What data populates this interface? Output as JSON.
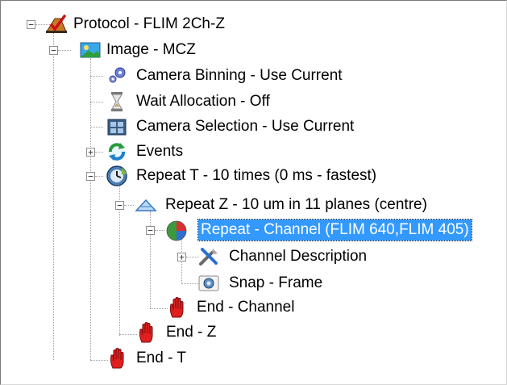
{
  "tree": {
    "nodes": [
      {
        "id": "protocol",
        "label": "Protocol - FLIM 2Ch-Z",
        "icon": "protocol-check-icon",
        "expander": "minus"
      },
      {
        "id": "image",
        "label": "Image - MCZ",
        "icon": "image-landscape-icon",
        "expander": "minus"
      },
      {
        "id": "binning",
        "label": "Camera Binning - Use Current",
        "icon": "gears-icon",
        "expander": ""
      },
      {
        "id": "wait",
        "label": "Wait Allocation - Off",
        "icon": "hourglass-icon",
        "expander": ""
      },
      {
        "id": "camsel",
        "label": "Camera Selection - Use Current",
        "icon": "film-camera-icon",
        "expander": ""
      },
      {
        "id": "events",
        "label": "Events",
        "icon": "refresh-arrows-icon",
        "expander": "plus"
      },
      {
        "id": "repeat_t",
        "label": "Repeat T - 10 times (0 ms - fastest)",
        "icon": "clock-globe-icon",
        "expander": "minus"
      },
      {
        "id": "repeat_z",
        "label": "Repeat Z - 10 um in 11 planes (centre)",
        "icon": "z-stack-triangle-icon",
        "expander": "minus"
      },
      {
        "id": "repeat_ch",
        "label": "Repeat - Channel (FLIM 640,FLIM 405)",
        "icon": "pie-channel-icon",
        "expander": "minus",
        "selected": true
      },
      {
        "id": "chdesc",
        "label": "Channel Description",
        "icon": "tools-icon",
        "expander": "plus"
      },
      {
        "id": "snap",
        "label": "Snap - Frame",
        "icon": "snap-camera-icon",
        "expander": ""
      },
      {
        "id": "end_ch",
        "label": "End - Channel",
        "icon": "stop-hand-icon",
        "expander": ""
      },
      {
        "id": "end_z",
        "label": "End - Z",
        "icon": "stop-hand-icon",
        "expander": ""
      },
      {
        "id": "end_t",
        "label": "End - T",
        "icon": "stop-hand-icon",
        "expander": ""
      }
    ]
  },
  "colors": {
    "selection": "#3399ff",
    "stop": "#e02020"
  }
}
